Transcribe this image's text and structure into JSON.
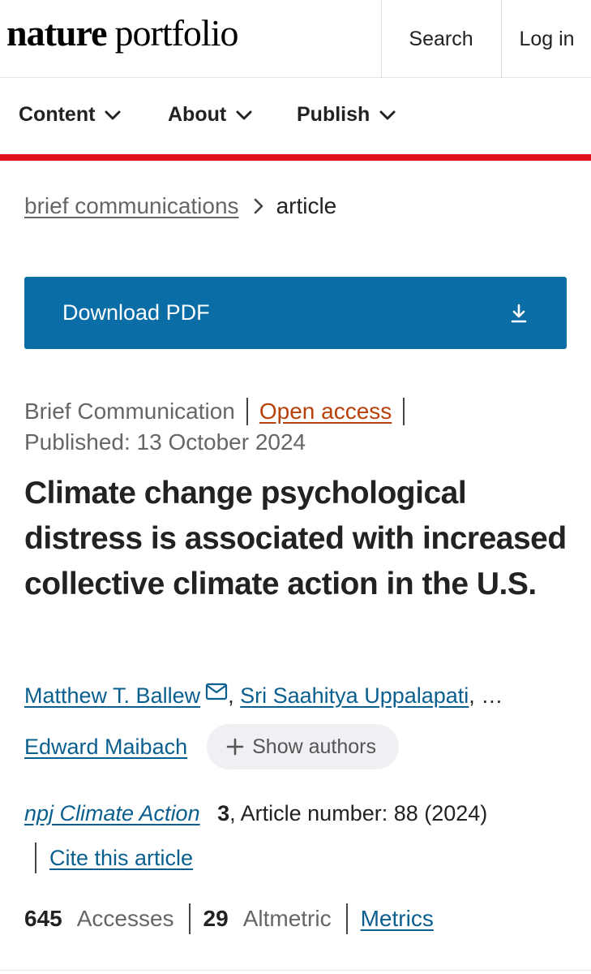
{
  "header": {
    "logo_word1": "nature",
    "logo_word2": "portfolio",
    "search_label": "Search",
    "login_label": "Log in"
  },
  "nav": {
    "items": [
      {
        "label": "Content"
      },
      {
        "label": "About"
      },
      {
        "label": "Publish"
      }
    ],
    "accent_color": "#e0121b"
  },
  "breadcrumb": {
    "parent": "brief communications",
    "current": "article"
  },
  "download": {
    "label": "Download PDF",
    "color": "#0b6da6"
  },
  "article": {
    "type": "Brief Communication",
    "access": "Open access",
    "published": "Published: 13 October 2024",
    "title": "Climate change psychological distress is associated with increased collective climate action in the U.S.",
    "authors": {
      "first": "Matthew T. Ballew",
      "second": "Sri Saahitya Uppalapati",
      "ellipsis": "…",
      "last": "Edward Maibach",
      "show_authors": "Show authors"
    },
    "journal": {
      "name": "npj Climate Action",
      "volume": "3",
      "article_number": ", Article number: 88 (2024)",
      "cite": "Cite this article"
    },
    "metrics": {
      "accesses_count": "645",
      "accesses_label": "Accesses",
      "altmetric_count": "29",
      "altmetric_label": "Altmetric",
      "metrics_link": "Metrics"
    }
  }
}
